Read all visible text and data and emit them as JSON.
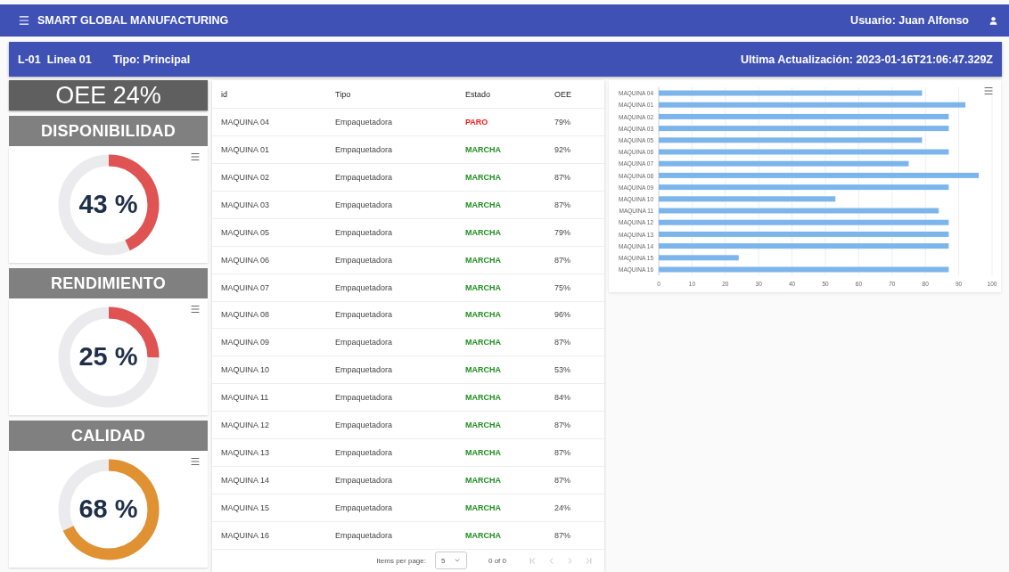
{
  "app_bar": {
    "title": "SMART GLOBAL MANUFACTURING",
    "user": "Usuario: Juan Alfonso"
  },
  "line_bar": {
    "line": "L-01  Linea 01",
    "type": "Tipo: Principal",
    "updated": "Ultima Actualización: 2023-01-16T21:06:47.329Z"
  },
  "oee": "OEE 24%",
  "gauges": [
    {
      "title": "DISPONIBILIDAD",
      "value": "43 %",
      "level": 0.43,
      "color": "#e05353"
    },
    {
      "title": "RENDIMIENTO",
      "value": "25 %",
      "level": 0.25,
      "color": "#e05353"
    },
    {
      "title": "CALIDAD",
      "value": "68 %",
      "level": 0.68,
      "color": "#e09132"
    }
  ],
  "table": {
    "columns": [
      "id",
      "Tipo",
      "Estado",
      "OEE"
    ],
    "rows": [
      {
        "id": "MAQUINA 04",
        "tipo": "Empaquetadora",
        "estado": "PARO",
        "kind": "stopped",
        "oee": "79%"
      },
      {
        "id": "MAQUINA 01",
        "tipo": "Empaquetadora",
        "estado": "MARCHA",
        "kind": "running",
        "oee": "92%"
      },
      {
        "id": "MAQUINA 02",
        "tipo": "Empaquetadora",
        "estado": "MARCHA",
        "kind": "running",
        "oee": "87%"
      },
      {
        "id": "MAQUINA 03",
        "tipo": "Empaquetadora",
        "estado": "MARCHA",
        "kind": "running",
        "oee": "87%"
      },
      {
        "id": "MAQUINA 05",
        "tipo": "Empaquetadora",
        "estado": "MARCHA",
        "kind": "running",
        "oee": "79%"
      },
      {
        "id": "MAQUINA 06",
        "tipo": "Empaquetadora",
        "estado": "MARCHA",
        "kind": "running",
        "oee": "87%"
      },
      {
        "id": "MAQUINA 07",
        "tipo": "Empaquetadora",
        "estado": "MARCHA",
        "kind": "running",
        "oee": "75%"
      },
      {
        "id": "MAQUINA 08",
        "tipo": "Empaquetadora",
        "estado": "MARCHA",
        "kind": "running",
        "oee": "96%"
      },
      {
        "id": "MAQUINA 09",
        "tipo": "Empaquetadora",
        "estado": "MARCHA",
        "kind": "running",
        "oee": "87%"
      },
      {
        "id": "MAQUINA 10",
        "tipo": "Empaquetadora",
        "estado": "MARCHA",
        "kind": "running",
        "oee": "53%"
      },
      {
        "id": "MAQUINA 11",
        "tipo": "Empaquetadora",
        "estado": "MARCHA",
        "kind": "running",
        "oee": "84%"
      },
      {
        "id": "MAQUINA 12",
        "tipo": "Empaquetadora",
        "estado": "MARCHA",
        "kind": "running",
        "oee": "87%"
      },
      {
        "id": "MAQUINA 13",
        "tipo": "Empaquetadora",
        "estado": "MARCHA",
        "kind": "running",
        "oee": "87%"
      },
      {
        "id": "MAQUINA 14",
        "tipo": "Empaquetadora",
        "estado": "MARCHA",
        "kind": "running",
        "oee": "87%"
      },
      {
        "id": "MAQUINA 15",
        "tipo": "Empaquetadora",
        "estado": "MARCHA",
        "kind": "running",
        "oee": "24%"
      },
      {
        "id": "MAQUINA 16",
        "tipo": "Empaquetadora",
        "estado": "MARCHA",
        "kind": "running",
        "oee": "87%"
      }
    ],
    "pagination": {
      "items_label": "Items per page:",
      "page_size": "5",
      "range": "0 of 0"
    }
  },
  "chart": {
    "chart_data": {
      "type": "bar",
      "orientation": "horizontal",
      "categories": [
        "MAQUINA 04",
        "MAQUINA 01",
        "MAQUINA 02",
        "MAQUINA 03",
        "MAQUINA 05",
        "MAQUINA 06",
        "MAQUINA 07",
        "MAQUINA 08",
        "MAQUINA 09",
        "MAQUINA 10",
        "MAQUINA 11",
        "MAQUINA 12",
        "MAQUINA 13",
        "MAQUINA 14",
        "MAQUINA 15",
        "MAQUINA 16"
      ],
      "grid": true,
      "series": [
        {
          "color": "#7cb5ec",
          "values": [
            79,
            92,
            87,
            87,
            79,
            87,
            75,
            96,
            87,
            53,
            84,
            87,
            87,
            87,
            24,
            87
          ]
        }
      ],
      "xlim": [
        0,
        100
      ],
      "xticks": [
        0,
        10,
        20,
        30,
        40,
        50,
        60,
        70,
        80,
        90,
        100
      ]
    }
  }
}
